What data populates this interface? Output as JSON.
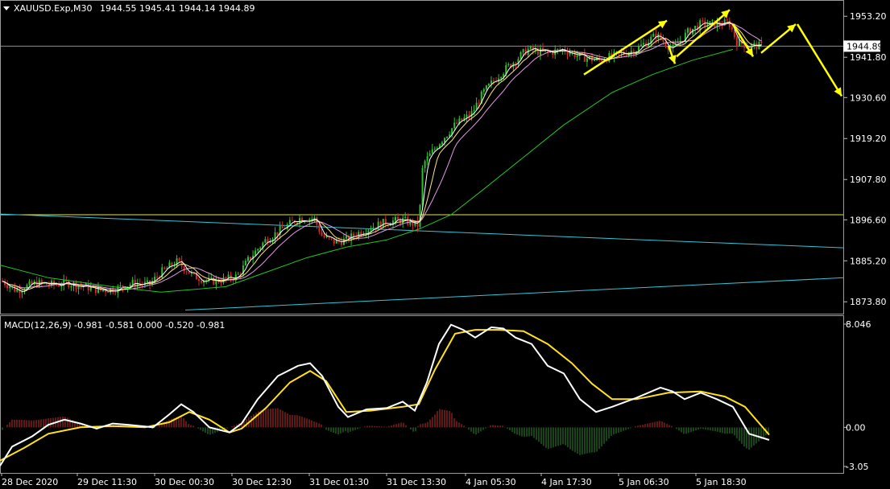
{
  "header": {
    "symbol": "XAUUSD.Exp,M30",
    "ohlc": "1944.55 1945.41 1944.14 1944.89"
  },
  "macd_header": "MACD(12,26,9) -0.981 -0.581 0.000 -0.520 -0.981",
  "price_axis": {
    "labels": [
      "1953.20",
      "1941.80",
      "1930.60",
      "1919.20",
      "1907.80",
      "1896.60",
      "1885.20",
      "1873.80"
    ],
    "current_price": "1944.89"
  },
  "macd_axis": {
    "labels": [
      "8.046",
      "0.00",
      "-3.05"
    ]
  },
  "time_axis": {
    "labels": [
      "28 Dec 2020",
      "29 Dec 11:30",
      "30 Dec 00:30",
      "30 Dec 12:30",
      "31 Dec 01:30",
      "31 Dec 13:30",
      "4 Jan 05:30",
      "4 Jan 17:30",
      "5 Jan 06:30",
      "5 Jan 18:30"
    ]
  },
  "colors": {
    "background": "#000000",
    "bull_candle": "#2fbf2f",
    "bear_candle": "#d42a2a",
    "ma_fast": "#ffffff",
    "ma_mid": "#ffe680",
    "ma_slow": "#e39be6",
    "ma_long": "#22c722",
    "trendline": "#33c5d6",
    "horizontal_line": "#e6e64d",
    "arrows": "#ffff00",
    "macd_line": "#ffffff",
    "signal_line": "#ffe21a",
    "hist_positive": "#c0302e",
    "hist_negative": "#2f8a2f"
  },
  "chart_data": [
    {
      "type": "candlestick",
      "symbol": "XAUUSD.Exp",
      "timeframe": "M30",
      "ylim": [
        1870.5,
        1957.5
      ],
      "price_path": [
        [
          0,
          1880
        ],
        [
          20,
          1877
        ],
        [
          45,
          1879
        ],
        [
          65,
          1878.5
        ],
        [
          85,
          1879
        ],
        [
          105,
          1878
        ],
        [
          125,
          1877
        ],
        [
          145,
          1877.5
        ],
        [
          165,
          1879
        ],
        [
          185,
          1878.5
        ],
        [
          200,
          1882
        ],
        [
          220,
          1885
        ],
        [
          240,
          1881
        ],
        [
          260,
          1879.5
        ],
        [
          280,
          1880
        ],
        [
          295,
          1881
        ],
        [
          310,
          1886
        ],
        [
          330,
          1891
        ],
        [
          350,
          1894
        ],
        [
          370,
          1897
        ],
        [
          390,
          1897
        ],
        [
          400,
          1892
        ],
        [
          415,
          1890.5
        ],
        [
          430,
          1891
        ],
        [
          445,
          1893
        ],
        [
          460,
          1894.5
        ],
        [
          480,
          1896
        ],
        [
          500,
          1896.5
        ],
        [
          520,
          1895
        ],
        [
          525,
          1912
        ],
        [
          545,
          1918
        ],
        [
          565,
          1923
        ],
        [
          585,
          1926
        ],
        [
          600,
          1932
        ],
        [
          620,
          1937
        ],
        [
          640,
          1941
        ],
        [
          655,
          1944
        ],
        [
          680,
          1943
        ],
        [
          700,
          1944
        ],
        [
          720,
          1942
        ],
        [
          740,
          1941
        ],
        [
          760,
          1942
        ],
        [
          790,
          1944
        ],
        [
          815,
          1948
        ],
        [
          835,
          1944
        ],
        [
          855,
          1949
        ],
        [
          870,
          1951
        ],
        [
          890,
          1951
        ],
        [
          905,
          1951.5
        ],
        [
          915,
          1946
        ],
        [
          930,
          1945
        ],
        [
          950,
          1944.9
        ]
      ],
      "moving_averages": {
        "ma_long": [
          [
            0,
            1884
          ],
          [
            60,
            1880.5
          ],
          [
            140,
            1878
          ],
          [
            200,
            1876.5
          ],
          [
            280,
            1878
          ],
          [
            330,
            1882
          ],
          [
            380,
            1886
          ],
          [
            430,
            1889
          ],
          [
            480,
            1891
          ],
          [
            520,
            1894
          ],
          [
            560,
            1898
          ],
          [
            600,
            1905
          ],
          [
            650,
            1914
          ],
          [
            700,
            1923
          ],
          [
            760,
            1932
          ],
          [
            810,
            1937
          ],
          [
            860,
            1941
          ],
          [
            910,
            1944
          ]
        ]
      },
      "horizontal_line": 1898,
      "trendlines": [
        {
          "from": [
            0,
            1898.2
          ],
          "to": [
            1048,
            1888.8
          ]
        },
        {
          "from": [
            230,
            1871.5
          ],
          "to": [
            1048,
            1880.5
          ]
        }
      ],
      "annotations": {
        "arrows": [
          {
            "from": [
              725,
              1937
            ],
            "to": [
              828,
              1952
            ]
          },
          {
            "from": [
              830,
              1945
            ],
            "to": [
              838,
              1940
            ]
          },
          {
            "from": [
              840,
              1942
            ],
            "to": [
              906,
              1955
            ]
          },
          {
            "from": [
              910,
              1951
            ],
            "to": [
              935,
              1942
            ]
          },
          {
            "from": [
              945,
              1943
            ],
            "to": [
              988,
              1951
            ]
          },
          {
            "from": [
              990,
              1951
            ],
            "to": [
              1045,
              1931
            ]
          }
        ]
      }
    },
    {
      "type": "line",
      "title": "MACD(12,26,9)",
      "ylim": [
        -3.05,
        8.046
      ],
      "macd_line": [
        [
          0,
          -3.0
        ],
        [
          15,
          -1.5
        ],
        [
          40,
          -0.7
        ],
        [
          60,
          0.2
        ],
        [
          80,
          0.6
        ],
        [
          100,
          0.3
        ],
        [
          120,
          -0.1
        ],
        [
          140,
          0.3
        ],
        [
          160,
          0.2
        ],
        [
          190,
          0.0
        ],
        [
          210,
          1.0
        ],
        [
          225,
          1.8
        ],
        [
          240,
          1.2
        ],
        [
          260,
          0.0
        ],
        [
          285,
          -0.4
        ],
        [
          300,
          0.3
        ],
        [
          320,
          2.2
        ],
        [
          345,
          4.0
        ],
        [
          370,
          4.8
        ],
        [
          385,
          5.0
        ],
        [
          400,
          4.0
        ],
        [
          420,
          1.6
        ],
        [
          432,
          0.8
        ],
        [
          455,
          1.4
        ],
        [
          480,
          1.5
        ],
        [
          500,
          2.0
        ],
        [
          515,
          1.3
        ],
        [
          530,
          3.5
        ],
        [
          545,
          6.5
        ],
        [
          560,
          8.0
        ],
        [
          575,
          7.6
        ],
        [
          590,
          7.0
        ],
        [
          610,
          7.8
        ],
        [
          625,
          7.7
        ],
        [
          640,
          7.0
        ],
        [
          660,
          6.5
        ],
        [
          680,
          4.8
        ],
        [
          700,
          4.2
        ],
        [
          720,
          2.2
        ],
        [
          740,
          1.2
        ],
        [
          760,
          1.6
        ],
        [
          790,
          2.3
        ],
        [
          820,
          3.1
        ],
        [
          835,
          2.8
        ],
        [
          850,
          2.2
        ],
        [
          870,
          2.7
        ],
        [
          890,
          2.2
        ],
        [
          910,
          1.6
        ],
        [
          930,
          -0.5
        ],
        [
          955,
          -0.98
        ]
      ],
      "signal_line": [
        [
          0,
          -2.6
        ],
        [
          30,
          -1.6
        ],
        [
          60,
          -0.5
        ],
        [
          100,
          0.0
        ],
        [
          140,
          0.1
        ],
        [
          180,
          0.0
        ],
        [
          210,
          0.4
        ],
        [
          235,
          1.2
        ],
        [
          260,
          0.6
        ],
        [
          285,
          -0.4
        ],
        [
          300,
          -0.1
        ],
        [
          330,
          1.5
        ],
        [
          360,
          3.5
        ],
        [
          385,
          4.4
        ],
        [
          405,
          3.6
        ],
        [
          430,
          1.2
        ],
        [
          460,
          1.3
        ],
        [
          500,
          1.6
        ],
        [
          520,
          1.8
        ],
        [
          540,
          4.5
        ],
        [
          565,
          7.3
        ],
        [
          590,
          7.6
        ],
        [
          620,
          7.6
        ],
        [
          650,
          7.5
        ],
        [
          680,
          6.5
        ],
        [
          710,
          5.0
        ],
        [
          735,
          3.4
        ],
        [
          760,
          2.2
        ],
        [
          790,
          2.2
        ],
        [
          830,
          2.7
        ],
        [
          870,
          2.8
        ],
        [
          900,
          2.4
        ],
        [
          925,
          1.6
        ],
        [
          955,
          -0.58
        ]
      ],
      "histogram_note": "values = MACD - signal, red above zero, green below"
    }
  ]
}
